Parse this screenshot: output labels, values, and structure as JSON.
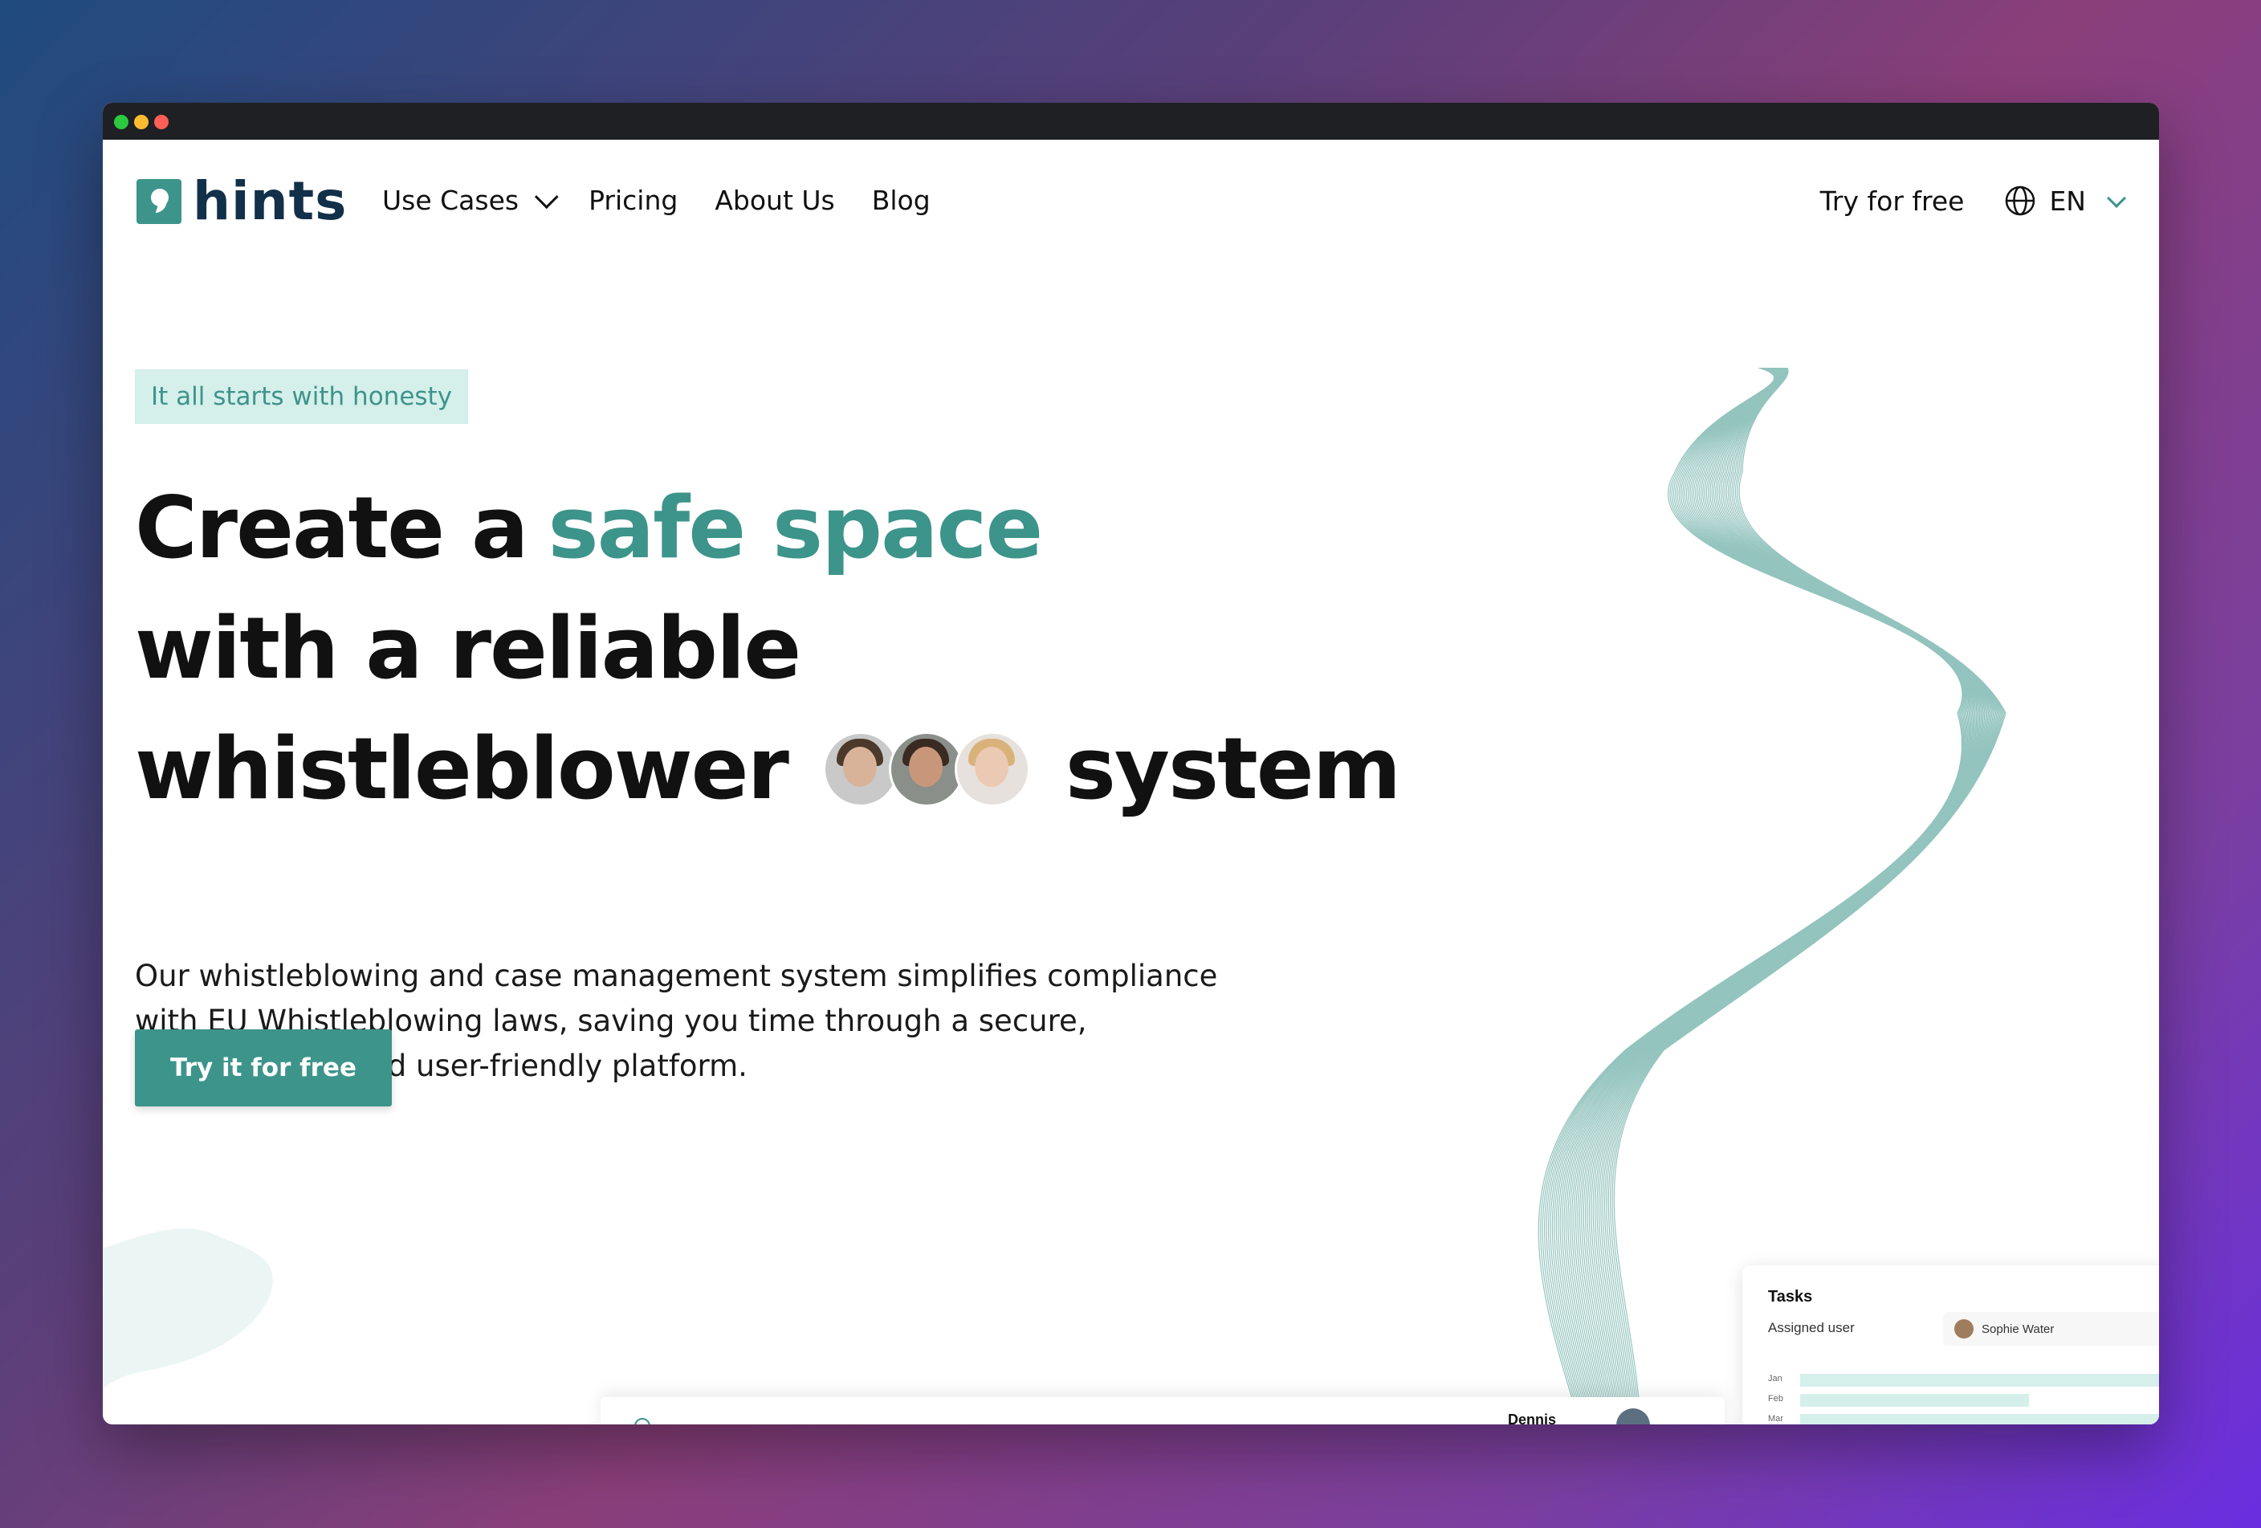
{
  "window": {
    "controls": [
      "close",
      "minimize",
      "maximize"
    ]
  },
  "nav": {
    "logo_text": "hints",
    "menu": [
      {
        "label": "Use Cases",
        "has_dropdown": true
      },
      {
        "label": "Pricing"
      },
      {
        "label": "About Us"
      },
      {
        "label": "Blog"
      }
    ],
    "try_link": "Try for free",
    "language": "EN"
  },
  "hero": {
    "tagline": "It all starts with honesty",
    "headline_line1_prefix": "Create a",
    "headline_line1_accent": "safe space",
    "headline_line2": "with a reliable",
    "headline_line3_prefix": "whistleblower",
    "headline_line3_suffix": "system",
    "description": "Our whistleblowing and case management system simplifies compliance with EU Whistleblowing laws, saving you time through a secure, customizable, and user-friendly platform.",
    "cta": "Try it for free"
  },
  "preview_cards": {
    "bottom_card": {
      "name": "Dennis"
    },
    "tasks_card": {
      "title": "Tasks",
      "assigned_label": "Assigned user",
      "assigned_user": "Sophie Water",
      "rows": [
        "Jan",
        "Feb",
        "Mar"
      ]
    }
  },
  "colors": {
    "accent": "#3d948a",
    "tag_bg": "#d5efeb",
    "logo_text": "#13304a"
  }
}
